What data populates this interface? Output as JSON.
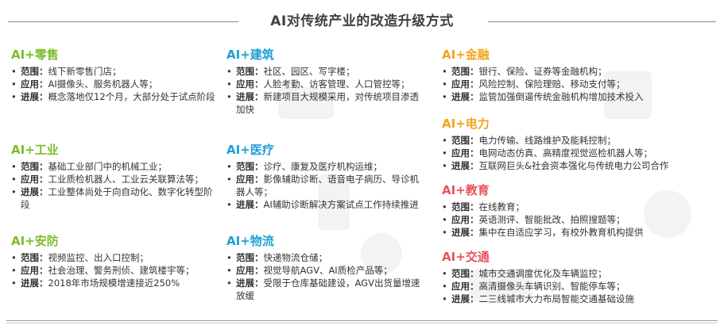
{
  "title": "AI对传统产业的改造升级方式",
  "bullet": "•",
  "colors": {
    "green": "#7cbd2a",
    "blue": "#1f9fd6",
    "orange": "#f2a41f",
    "red": "#e8545b"
  },
  "sections": [
    {
      "title": "AI+零售",
      "items": [
        {
          "label": "范围：",
          "text": "线下新零售门店；"
        },
        {
          "label": "应用：",
          "text": "AI摄像头、服务机器人等；"
        },
        {
          "label": "进展：",
          "text": "概念落地仅12个月，大部分处于试点阶段"
        }
      ]
    },
    {
      "title": "AI+工业",
      "items": [
        {
          "label": "范围：",
          "text": "基础工业部门中的机械工业；"
        },
        {
          "label": "应用：",
          "text": "工业质检机器人、工业云关联算法等；"
        },
        {
          "label": "进展：",
          "text": "工业整体尚处于向自动化、数字化转型阶段"
        }
      ]
    },
    {
      "title": "AI+安防",
      "items": [
        {
          "label": "范围：",
          "text": "视频监控、出入口控制；"
        },
        {
          "label": "应用：",
          "text": "社会治理、警务刑侦、建筑楼宇等；"
        },
        {
          "label": "进展：",
          "text": "2018年市场规模增速接近250%"
        }
      ]
    },
    {
      "title": "AI+建筑",
      "items": [
        {
          "label": "范围：",
          "text": "社区、园区、写字楼；"
        },
        {
          "label": "应用：",
          "text": "人脸考勤、访客管理、人口管控等；"
        },
        {
          "label": "进展：",
          "text": "新建项目大规模采用，对传统项目渗透加快"
        }
      ]
    },
    {
      "title": "AI+医疗",
      "items": [
        {
          "label": "范围：",
          "text": "诊疗、康复及医疗机构运维；"
        },
        {
          "label": "应用：",
          "text": "影像辅助诊断、语音电子病历、导诊机器人等；"
        },
        {
          "label": "进展：",
          "text": "AI辅助诊断解决方案试点工作持续推进"
        }
      ]
    },
    {
      "title": "AI+物流",
      "items": [
        {
          "label": "范围：",
          "text": "快递物流仓储；"
        },
        {
          "label": "应用：",
          "text": "视觉导航AGV、AI质检产品等；"
        },
        {
          "label": "进展：",
          "text": "受限于仓库基础建设，AGV出货量增速放缓"
        }
      ]
    },
    {
      "title": "AI+金融",
      "items": [
        {
          "label": "范围：",
          "text": "银行、保险、证券等金融机构；"
        },
        {
          "label": "应用：",
          "text": "风险控制、保险理赔、移动支付等；"
        },
        {
          "label": "进展：",
          "text": "监管加强倒逼传统金融机构增加技术投入"
        }
      ]
    },
    {
      "title": "AI+电力",
      "items": [
        {
          "label": "范围：",
          "text": "电力传输、线路维护及能耗控制；"
        },
        {
          "label": "应用：",
          "text": "电网动态仿真、高精度视觉巡检机器人等；"
        },
        {
          "label": "进展：",
          "text": "互联网巨头&社会资本强化与传统电力公司合作"
        }
      ]
    },
    {
      "title": "AI+教育",
      "items": [
        {
          "label": "范围：",
          "text": "在线教育；"
        },
        {
          "label": "应用：",
          "text": "英语测评、智能批改、拍照搜题等；"
        },
        {
          "label": "进展：",
          "text": "集中在自适应学习，有校外教育机构提供"
        }
      ]
    },
    {
      "title": "AI+交通",
      "items": [
        {
          "label": "范围：",
          "text": "城市交通调度优化及车辆监控；"
        },
        {
          "label": "应用：",
          "text": "高清摄像头车辆识别、智能停车等；"
        },
        {
          "label": "进展：",
          "text": "二三线城市大力布局智能交通基础设施"
        }
      ]
    }
  ]
}
